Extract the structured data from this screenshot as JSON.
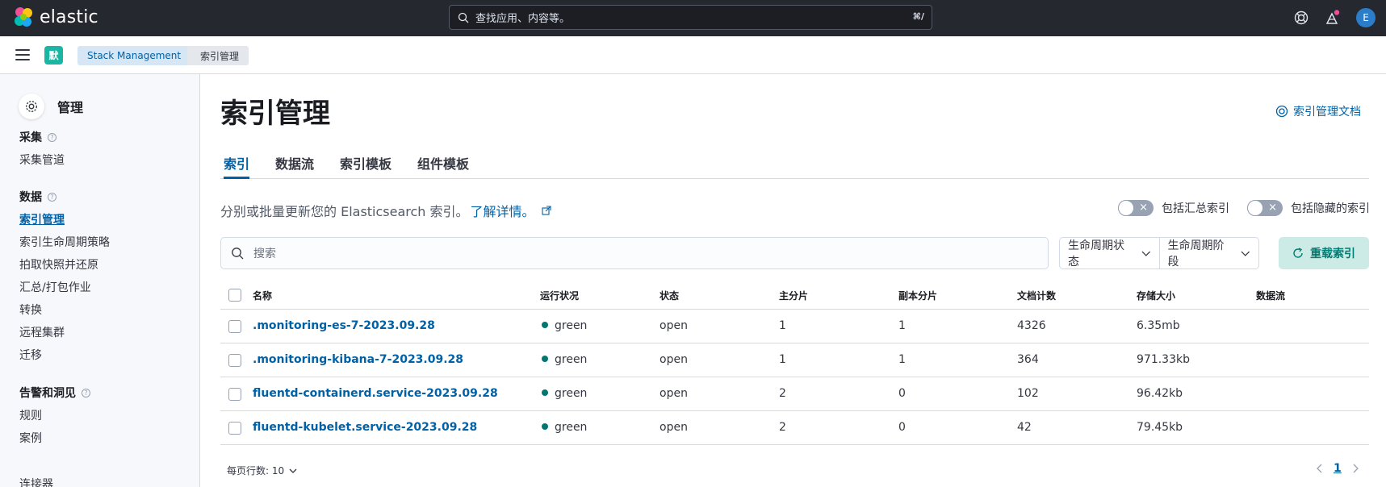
{
  "topbar": {
    "brand": "elastic",
    "search_placeholder": "查找应用、内容等。",
    "search_shortcut": "⌘/",
    "avatar_initial": "E"
  },
  "subbar": {
    "space_initial": "默",
    "breadcrumbs": [
      "Stack Management",
      "索引管理"
    ]
  },
  "sidebar": {
    "title": "管理",
    "groups": [
      {
        "label": "采集",
        "items": [
          "采集管道"
        ]
      },
      {
        "label": "数据",
        "items": [
          "索引管理",
          "索引生命周期策略",
          "拍取快照并还原",
          "汇总/打包作业",
          "转换",
          "远程集群",
          "迁移"
        ]
      },
      {
        "label": "告警和洞见",
        "items": [
          "规则",
          "案例",
          "连接器"
        ]
      }
    ]
  },
  "main": {
    "title": "索引管理",
    "doc_link": "索引管理文档",
    "tabs": [
      "索引",
      "数据流",
      "索引模板",
      "组件模板"
    ],
    "description": "分别或批量更新您的 Elasticsearch 索引。",
    "description_link": "了解详情。",
    "toggle_rollup": "包括汇总索引",
    "toggle_hidden": "包括隐藏的索引",
    "search_placeholder": "搜索",
    "filter_lifecycle_status": "生命周期状态",
    "filter_lifecycle_phase": "生命周期阶段",
    "reload_button": "重载索引",
    "columns": [
      "名称",
      "运行状况",
      "状态",
      "主分片",
      "副本分片",
      "文档计数",
      "存储大小",
      "数据流"
    ],
    "rows": [
      {
        "name": ".monitoring-es-7-2023.09.28",
        "health": "green",
        "status": "open",
        "primary": "1",
        "replicas": "1",
        "docs": "4326",
        "size": "6.35mb",
        "stream": ""
      },
      {
        "name": ".monitoring-kibana-7-2023.09.28",
        "health": "green",
        "status": "open",
        "primary": "1",
        "replicas": "1",
        "docs": "364",
        "size": "971.33kb",
        "stream": ""
      },
      {
        "name": "fluentd-containerd.service-2023.09.28",
        "health": "green",
        "status": "open",
        "primary": "2",
        "replicas": "0",
        "docs": "102",
        "size": "96.42kb",
        "stream": ""
      },
      {
        "name": "fluentd-kubelet.service-2023.09.28",
        "health": "green",
        "status": "open",
        "primary": "2",
        "replicas": "0",
        "docs": "42",
        "size": "79.45kb",
        "stream": ""
      }
    ],
    "rows_per_page": "每页行数: 10",
    "current_page": "1"
  }
}
